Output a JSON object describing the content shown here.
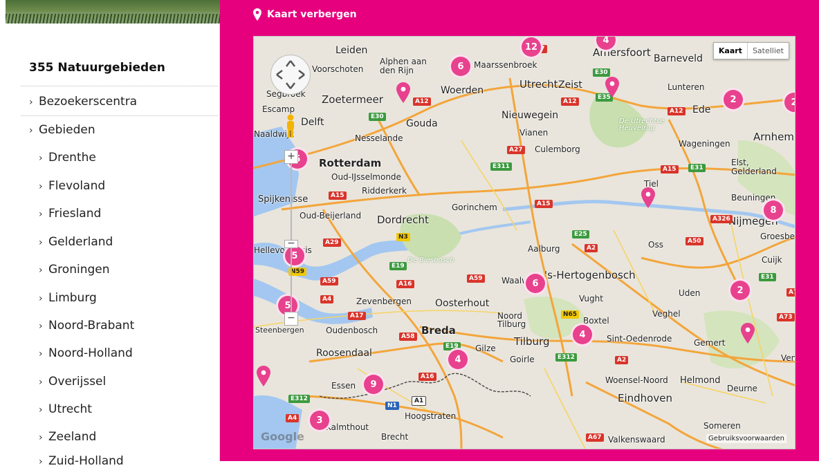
{
  "sidebar": {
    "count_title": "355 Natuurgebieden",
    "items": [
      {
        "label": "Bezoekerscentra"
      },
      {
        "label": "Gebieden"
      }
    ],
    "provinces": [
      {
        "label": "Drenthe"
      },
      {
        "label": "Flevoland"
      },
      {
        "label": "Friesland"
      },
      {
        "label": "Gelderland"
      },
      {
        "label": "Groningen"
      },
      {
        "label": "Limburg"
      },
      {
        "label": "Noord-Brabant"
      },
      {
        "label": "Noord-Holland"
      },
      {
        "label": "Overijssel"
      },
      {
        "label": "Utrecht"
      },
      {
        "label": "Zeeland"
      },
      {
        "label": "Zuid-Holland"
      }
    ]
  },
  "header": {
    "hide_map_label": "Kaart verbergen",
    "icon": "map-pin-icon"
  },
  "map": {
    "type_buttons": {
      "map": "Kaart",
      "satellite": "Satelliet"
    },
    "copyright": "Google",
    "terms": "Gebruiksvoorwaarden",
    "zoom_in": "+",
    "zoom_out": "−",
    "places": [
      {
        "name": "Leiden"
      },
      {
        "name": "Voorschoten"
      },
      {
        "name": "Alphen aan den Rijn"
      },
      {
        "name": "Maarssenbroek"
      },
      {
        "name": "Amersfoort"
      },
      {
        "name": "Barneveld"
      },
      {
        "name": "Segbroek"
      },
      {
        "name": "Zoetermeer"
      },
      {
        "name": "Woerden"
      },
      {
        "name": "Utrecht"
      },
      {
        "name": "Zeist"
      },
      {
        "name": "Lunteren"
      },
      {
        "name": "Escamp"
      },
      {
        "name": "Delft"
      },
      {
        "name": "Gouda"
      },
      {
        "name": "Nieuwegein"
      },
      {
        "name": "Ede"
      },
      {
        "name": "Naaldwijk"
      },
      {
        "name": "Nesselande"
      },
      {
        "name": "Vianen"
      },
      {
        "name": "Wageningen"
      },
      {
        "name": "Arnhem"
      },
      {
        "name": "Culemborg"
      },
      {
        "name": "Rotterdam"
      },
      {
        "name": "Oud-IJsselmonde"
      },
      {
        "name": "Ridderkerk"
      },
      {
        "name": "Spijkenisse"
      },
      {
        "name": "Tiel"
      },
      {
        "name": "Elst, Gelderland"
      },
      {
        "name": "Gorinchem"
      },
      {
        "name": "Beuningen"
      },
      {
        "name": "Oud-Beijerland"
      },
      {
        "name": "Dordrecht"
      },
      {
        "name": "Nijmegen"
      },
      {
        "name": "Hellevoetsluis"
      },
      {
        "name": "Aalburg"
      },
      {
        "name": "Oss"
      },
      {
        "name": "Groesbeek"
      },
      {
        "name": "Cuijk"
      },
      {
        "name": "Waalwijk"
      },
      {
        "name": "'s-Hertogenbosch"
      },
      {
        "name": "Zevenbergen"
      },
      {
        "name": "Oosterhout"
      },
      {
        "name": "Vught"
      },
      {
        "name": "Uden"
      },
      {
        "name": "Steenbergen"
      },
      {
        "name": "Oudenbosch"
      },
      {
        "name": "Breda"
      },
      {
        "name": "Noord Tilburg"
      },
      {
        "name": "Boxtel"
      },
      {
        "name": "Veghel"
      },
      {
        "name": "Tilburg"
      },
      {
        "name": "Sint-Oedenrode"
      },
      {
        "name": "Gemert"
      },
      {
        "name": "Roosendaal"
      },
      {
        "name": "Gilze"
      },
      {
        "name": "Goirle"
      },
      {
        "name": "Venray"
      },
      {
        "name": "Essen"
      },
      {
        "name": "Woensel-Noord"
      },
      {
        "name": "Helmond"
      },
      {
        "name": "Deurne"
      },
      {
        "name": "Eindhoven"
      },
      {
        "name": "Hoogstraten"
      },
      {
        "name": "Kalmthout"
      },
      {
        "name": "Someren"
      },
      {
        "name": "Brecht"
      },
      {
        "name": "Valkenswaard"
      },
      {
        "name": "De Utrechtse Heuvelrug"
      },
      {
        "name": "De Biesbosch"
      }
    ],
    "clusters": [
      {
        "n": "12"
      },
      {
        "n": "4"
      },
      {
        "n": "6"
      },
      {
        "n": "2"
      },
      {
        "n": "2"
      },
      {
        "n": "5"
      },
      {
        "n": "8"
      },
      {
        "n": "5"
      },
      {
        "n": "6"
      },
      {
        "n": "2"
      },
      {
        "n": "5"
      },
      {
        "n": "4"
      },
      {
        "n": "4"
      },
      {
        "n": "9"
      },
      {
        "n": "3"
      }
    ],
    "roads": [
      "A27",
      "E30",
      "A12",
      "E35",
      "A12",
      "A12",
      "E30",
      "A27",
      "E311",
      "A15",
      "E31",
      "A15",
      "A15",
      "A326",
      "A50",
      "E25",
      "A2",
      "A29",
      "N3",
      "E19",
      "N59",
      "A59",
      "A16",
      "A59",
      "A4",
      "A17",
      "N65",
      "A58",
      "E19",
      "E312",
      "A2",
      "E312",
      "A16",
      "N1",
      "A1",
      "A4",
      "A67",
      "E31",
      "A73",
      "A7"
    ],
    "colors": {
      "accent": "#e6007e",
      "cluster": "#e8418e",
      "water": "#a3c7f0",
      "land": "#e9e5dc"
    }
  }
}
